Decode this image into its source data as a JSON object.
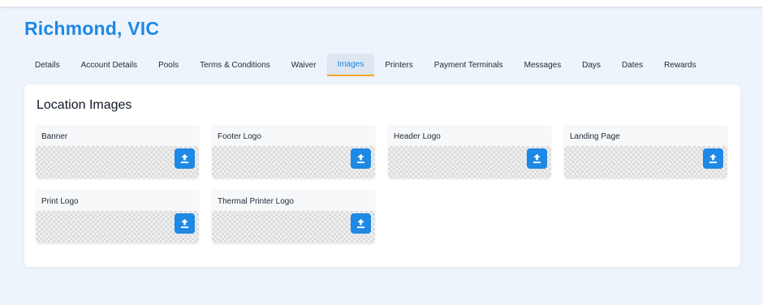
{
  "location": {
    "title": "Richmond, VIC"
  },
  "tabs": [
    {
      "label": "Details",
      "active": false
    },
    {
      "label": "Account Details",
      "active": false
    },
    {
      "label": "Pools",
      "active": false
    },
    {
      "label": "Terms & Conditions",
      "active": false
    },
    {
      "label": "Waiver",
      "active": false
    },
    {
      "label": "Images",
      "active": true
    },
    {
      "label": "Printers",
      "active": false
    },
    {
      "label": "Payment Terminals",
      "active": false
    },
    {
      "label": "Messages",
      "active": false
    },
    {
      "label": "Days",
      "active": false
    },
    {
      "label": "Dates",
      "active": false
    },
    {
      "label": "Rewards",
      "active": false
    }
  ],
  "section": {
    "title": "Location Images"
  },
  "images": [
    {
      "label": "Banner",
      "icon": "upload-icon"
    },
    {
      "label": "Footer Logo",
      "icon": "upload-icon"
    },
    {
      "label": "Header Logo",
      "icon": "upload-icon"
    },
    {
      "label": "Landing Page",
      "icon": "upload-icon"
    },
    {
      "label": "Print Logo",
      "icon": "upload-icon"
    },
    {
      "label": "Thermal Printer Logo",
      "icon": "upload-icon"
    }
  ],
  "colors": {
    "accent": "#1e88e5",
    "active_tab_underline": "#f5a623",
    "background": "#eef4fc"
  }
}
